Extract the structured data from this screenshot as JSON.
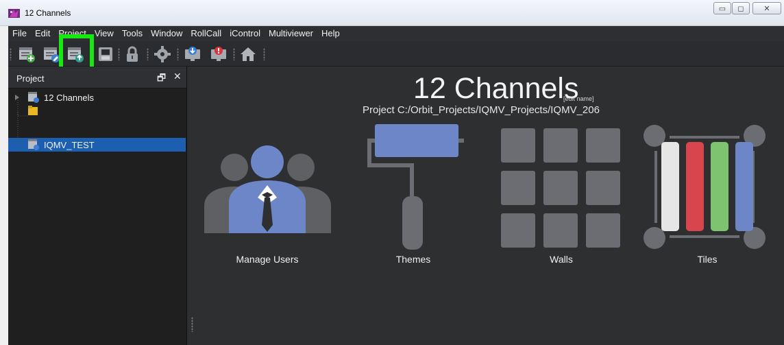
{
  "window": {
    "title": "12 Channels",
    "minimize": "▭",
    "maximize": "◻",
    "close": "✕"
  },
  "menu": [
    "File",
    "Edit",
    "Project",
    "View",
    "Tools",
    "Window",
    "RollCall",
    "iControl",
    "Multiviewer",
    "Help"
  ],
  "toolbar": {
    "icons": [
      "new-project-icon",
      "edit-project-icon",
      "upload-project-icon",
      "save-icon",
      "lock-icon",
      "settings-gear-icon",
      "monitor-download-icon",
      "monitor-alert-icon",
      "home-icon"
    ],
    "accent_highlight": "#17e811"
  },
  "panel": {
    "title": "Project",
    "float": "🗗",
    "close": "✕",
    "tree": [
      {
        "label": "12 Channels",
        "type": "project"
      },
      {
        "label": "",
        "type": "folder"
      },
      {
        "label": "IQMV_TEST",
        "type": "project",
        "selected": true
      }
    ]
  },
  "main": {
    "project_name": "12 Channels",
    "edit_name": "[edit name]",
    "project_path": "Project C:/Orbit_Projects/IQMV_Projects/IQMV_206",
    "tiles": [
      {
        "label": "Manage Users",
        "icon": "manage-users-icon"
      },
      {
        "label": "Themes",
        "icon": "paint-roller-icon"
      },
      {
        "label": "Walls",
        "icon": "walls-grid-icon"
      },
      {
        "label": "Tiles",
        "icon": "tiles-icon"
      }
    ]
  },
  "colors": {
    "accent_blue": "#6d86c8",
    "tile_gray": "#6b6d72",
    "selected": "#1c5fb0",
    "red": "#d9454c",
    "green": "#7ec470"
  }
}
